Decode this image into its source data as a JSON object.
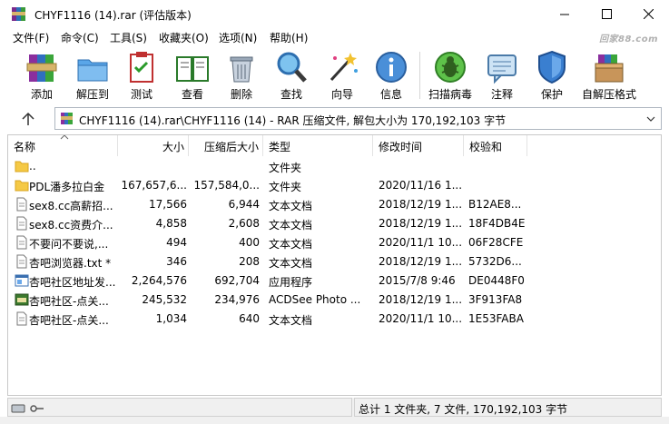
{
  "window": {
    "title": "CHYF1116 (14).rar (评估版本)"
  },
  "menu": {
    "items": [
      "文件(F)",
      "命令(C)",
      "工具(S)",
      "收藏夹(O)",
      "选项(N)",
      "帮助(H)"
    ],
    "watermark": "回家88.com"
  },
  "toolbar": {
    "buttons": [
      {
        "label": "添加",
        "icon": "add-archive-icon"
      },
      {
        "label": "解压到",
        "icon": "extract-to-icon"
      },
      {
        "label": "测试",
        "icon": "test-icon"
      },
      {
        "label": "查看",
        "icon": "view-book-icon"
      },
      {
        "label": "删除",
        "icon": "trash-icon"
      },
      {
        "label": "查找",
        "icon": "magnifier-icon"
      },
      {
        "label": "向导",
        "icon": "wizard-wand-icon"
      },
      {
        "label": "信息",
        "icon": "info-icon"
      },
      {
        "label": "扫描病毒",
        "icon": "virus-scan-icon"
      },
      {
        "label": "注释",
        "icon": "comment-icon"
      },
      {
        "label": "保护",
        "icon": "shield-icon"
      },
      {
        "label": "自解压格式",
        "icon": "sfx-box-icon"
      }
    ]
  },
  "address": {
    "path": "CHYF1116 (14).rar\\CHYF1116 (14) - RAR 压缩文件, 解包大小为 170,192,103 字节"
  },
  "columns": [
    "名称",
    "大小",
    "压缩后大小",
    "类型",
    "修改时间",
    "校验和"
  ],
  "files": [
    {
      "name": "..",
      "size": "",
      "packed": "",
      "type": "文件夹",
      "modified": "",
      "crc": "",
      "icon": "folder-icon"
    },
    {
      "name": "PDL潘多拉白金",
      "size": "167,657,6...",
      "packed": "157,584,0...",
      "type": "文件夹",
      "modified": "2020/11/16 1...",
      "crc": "",
      "icon": "folder-icon"
    },
    {
      "name": "sex8.cc高薪招...",
      "size": "17,566",
      "packed": "6,944",
      "type": "文本文档",
      "modified": "2018/12/19 1...",
      "crc": "B12AE8...",
      "icon": "text-file-icon"
    },
    {
      "name": "sex8.cc资费介...",
      "size": "4,858",
      "packed": "2,608",
      "type": "文本文档",
      "modified": "2018/12/19 1...",
      "crc": "18F4DB4E",
      "icon": "text-file-icon"
    },
    {
      "name": "不要问不要说,...",
      "size": "494",
      "packed": "400",
      "type": "文本文档",
      "modified": "2020/11/1 10...",
      "crc": "06F28CFE",
      "icon": "text-file-icon"
    },
    {
      "name": "杏吧浏览器.txt *",
      "size": "346",
      "packed": "208",
      "type": "文本文档",
      "modified": "2018/12/19 1...",
      "crc": "5732D6...",
      "icon": "text-file-icon"
    },
    {
      "name": "杏吧社区地址发...",
      "size": "2,264,576",
      "packed": "692,704",
      "type": "应用程序",
      "modified": "2015/7/8 9:46",
      "crc": "DE0448F0",
      "icon": "app-file-icon"
    },
    {
      "name": "杏吧社区-点关...",
      "size": "245,532",
      "packed": "234,976",
      "type": "ACDSee Photo ...",
      "modified": "2018/12/19 1...",
      "crc": "3F913FA8",
      "icon": "jpg-file-icon"
    },
    {
      "name": "杏吧社区-点关...",
      "size": "1,034",
      "packed": "640",
      "type": "文本文档",
      "modified": "2020/11/1 10...",
      "crc": "1E53FABA",
      "icon": "text-file-icon"
    }
  ],
  "status": {
    "summary": "总计 1 文件夹, 7 文件, 170,192,103 字节",
    "left_icon": "drive-key-icon"
  }
}
